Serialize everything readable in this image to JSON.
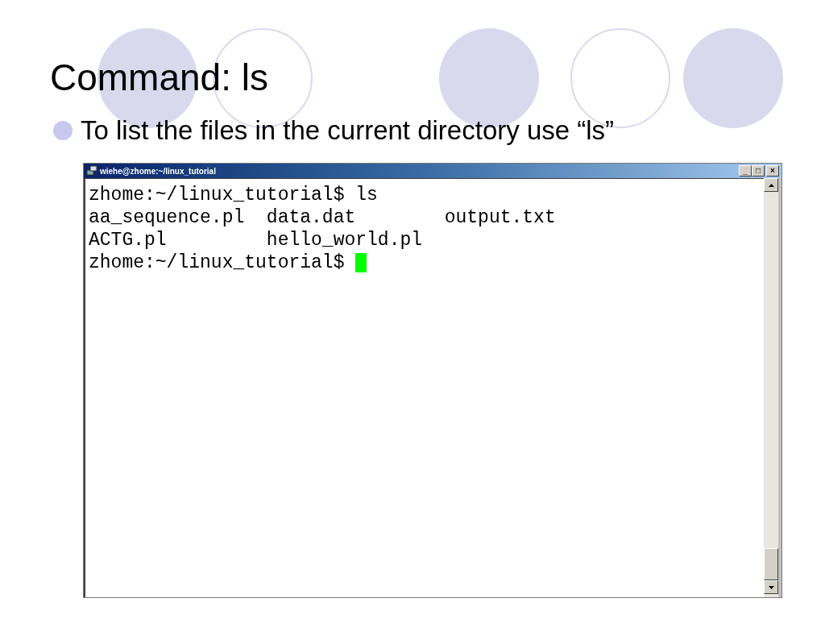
{
  "slide": {
    "title": "Command: ls",
    "bullets": [
      "To list the files in the current directory use “ls”"
    ]
  },
  "terminal": {
    "title": "wiehe@zhome:~/linux_tutorial",
    "controls": [
      "_",
      "□",
      "×"
    ],
    "lines": [
      "zhome:~/linux_tutorial$ ls",
      "aa_sequence.pl  data.dat        output.txt",
      "ACTG.pl         hello_world.pl",
      "zhome:~/linux_tutorial$ "
    ],
    "cursor": {
      "visible": true,
      "color": "#00ff00"
    }
  }
}
